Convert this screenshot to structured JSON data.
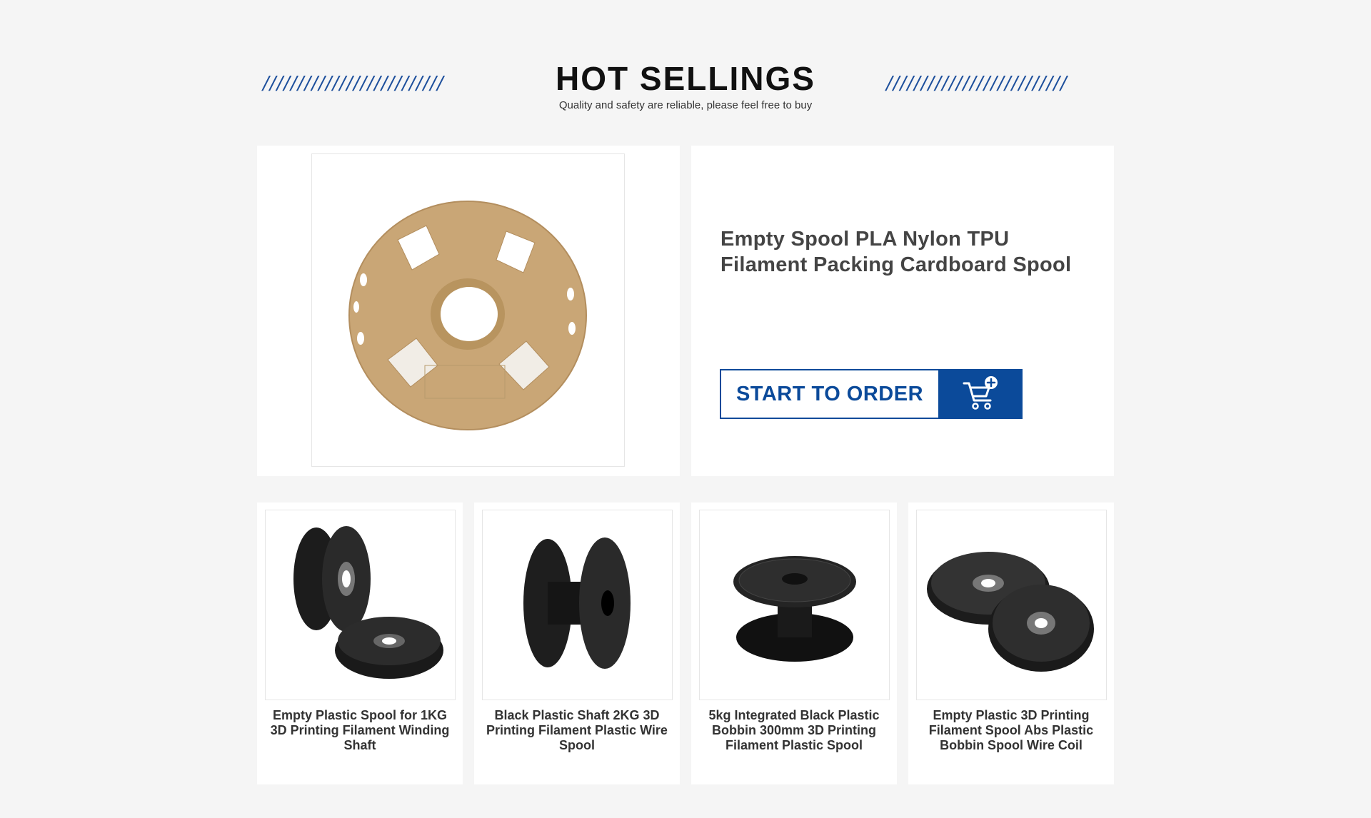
{
  "header": {
    "title": "HOT SELLINGS",
    "subtitle": "Quality and safety are reliable, please feel free to buy",
    "slashes": "//////////////////////////"
  },
  "featured": {
    "title": "Empty Spool PLA Nylon TPU Filament Packing Cardboard Spool",
    "button_label": "START TO ORDER",
    "button_icon": "cart-plus-icon",
    "image": "cardboard-spool-image"
  },
  "products": [
    {
      "name": "Empty Plastic Spool for 1KG 3D Printing Filament Winding Shaft",
      "image": "black-spool-pair-image"
    },
    {
      "name": "Black Plastic Shaft 2KG 3D Printing Filament Plastic Wire Spool",
      "image": "black-shaft-spool-image"
    },
    {
      "name": "5kg Integrated Black Plastic Bobbin 300mm 3D Printing Filament Plastic Spool",
      "image": "black-bobbin-image"
    },
    {
      "name": "Empty Plastic 3D Printing Filament Spool Abs Plastic Bobbin Spool Wire Coil",
      "image": "black-abs-spools-image"
    }
  ],
  "colors": {
    "accent": "#0b4a9a",
    "background": "#f5f5f5",
    "card": "#ffffff",
    "cardboard": "#c9a676"
  }
}
